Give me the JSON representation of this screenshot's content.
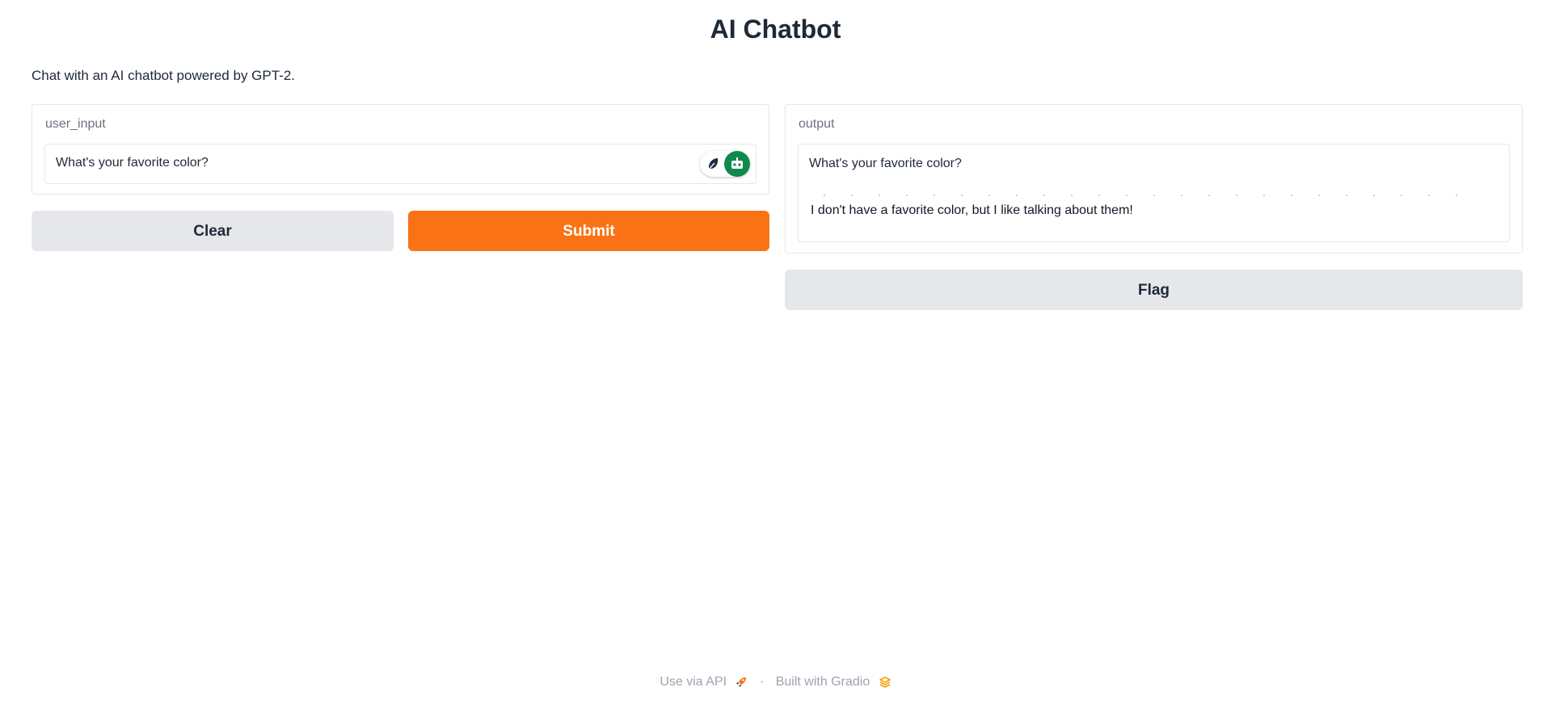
{
  "header": {
    "title": "AI Chatbot",
    "description": "Chat with an AI chatbot powered by GPT-2."
  },
  "input_panel": {
    "label": "user_input",
    "value": "What's your favorite color?",
    "extension_icons": [
      "feather-icon",
      "bot-icon"
    ]
  },
  "output_panel": {
    "label": "output",
    "prompt_line": "What's your favorite color?",
    "response_line": "I don't have a favorite color, but I like talking about them!"
  },
  "buttons": {
    "clear": "Clear",
    "submit": "Submit",
    "flag": "Flag"
  },
  "footer": {
    "api_label": "Use via API",
    "separator": "·",
    "built_with": "Built with Gradio",
    "api_icon": "rocket-icon",
    "gradio_icon": "gradio-logo-icon"
  },
  "colors": {
    "primary": "#f97316",
    "secondary": "#e5e7eb",
    "extension_green": "#0f8a4e",
    "gradio_logo": "#f59e0b"
  }
}
